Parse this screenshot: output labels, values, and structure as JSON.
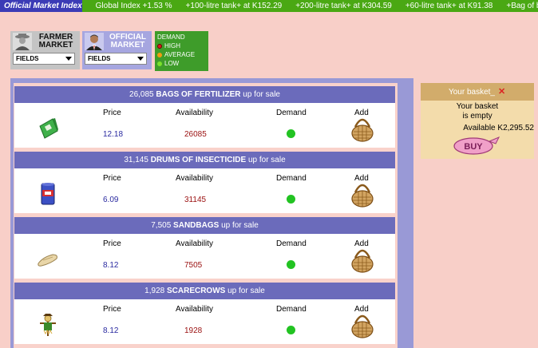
{
  "ticker": {
    "title": "Official Market Index",
    "items": [
      "Global Index +1.53 %",
      "+100-litre tank+ at K152.29",
      "+200-litre tank+ at K304.59",
      "+60-litre tank+ at K91.38",
      "+Bag of bee"
    ]
  },
  "markets": {
    "farmer": {
      "line1": "FARMER",
      "line2": "MARKET",
      "select": "FIELDS"
    },
    "official": {
      "line1": "OFFICIAL",
      "line2": "MARKET",
      "select": "FIELDS"
    }
  },
  "legend": {
    "title": "DEMAND",
    "levels": [
      {
        "label": "HIGH",
        "color": "#d81c1c"
      },
      {
        "label": "AVERAGE",
        "color": "#f29b11"
      },
      {
        "label": "LOW",
        "color": "#7be02a"
      }
    ]
  },
  "columns": {
    "price": "Price",
    "availability": "Availability",
    "demand": "Demand",
    "add": "Add"
  },
  "products": [
    {
      "count": "26,085",
      "name": "BAGS OF FERTILIZER",
      "suffix": "up for sale",
      "price": "12.18",
      "availability": "26085",
      "icon": "fertilizer-bag-icon"
    },
    {
      "count": "31,145",
      "name": "DRUMS OF INSECTICIDE",
      "suffix": "up for sale",
      "price": "6.09",
      "availability": "31145",
      "icon": "insecticide-drum-icon"
    },
    {
      "count": "7,505",
      "name": "SANDBAGS",
      "suffix": "up for sale",
      "price": "8.12",
      "availability": "7505",
      "icon": "sandbag-icon"
    },
    {
      "count": "1,928",
      "name": "SCARECROWS",
      "suffix": "up for sale",
      "price": "8.12",
      "availability": "1928",
      "icon": "scarecrow-icon"
    }
  ],
  "basket": {
    "title": "Your basket_",
    "empty_line1": "Your basket",
    "empty_line2": "is empty",
    "available": "Available K2,295.52",
    "buy_label": "BUY"
  },
  "colors": {
    "ticker_bg": "#4aa813",
    "header_bar": "#6b6bbb",
    "demand_low": "#22c322"
  }
}
